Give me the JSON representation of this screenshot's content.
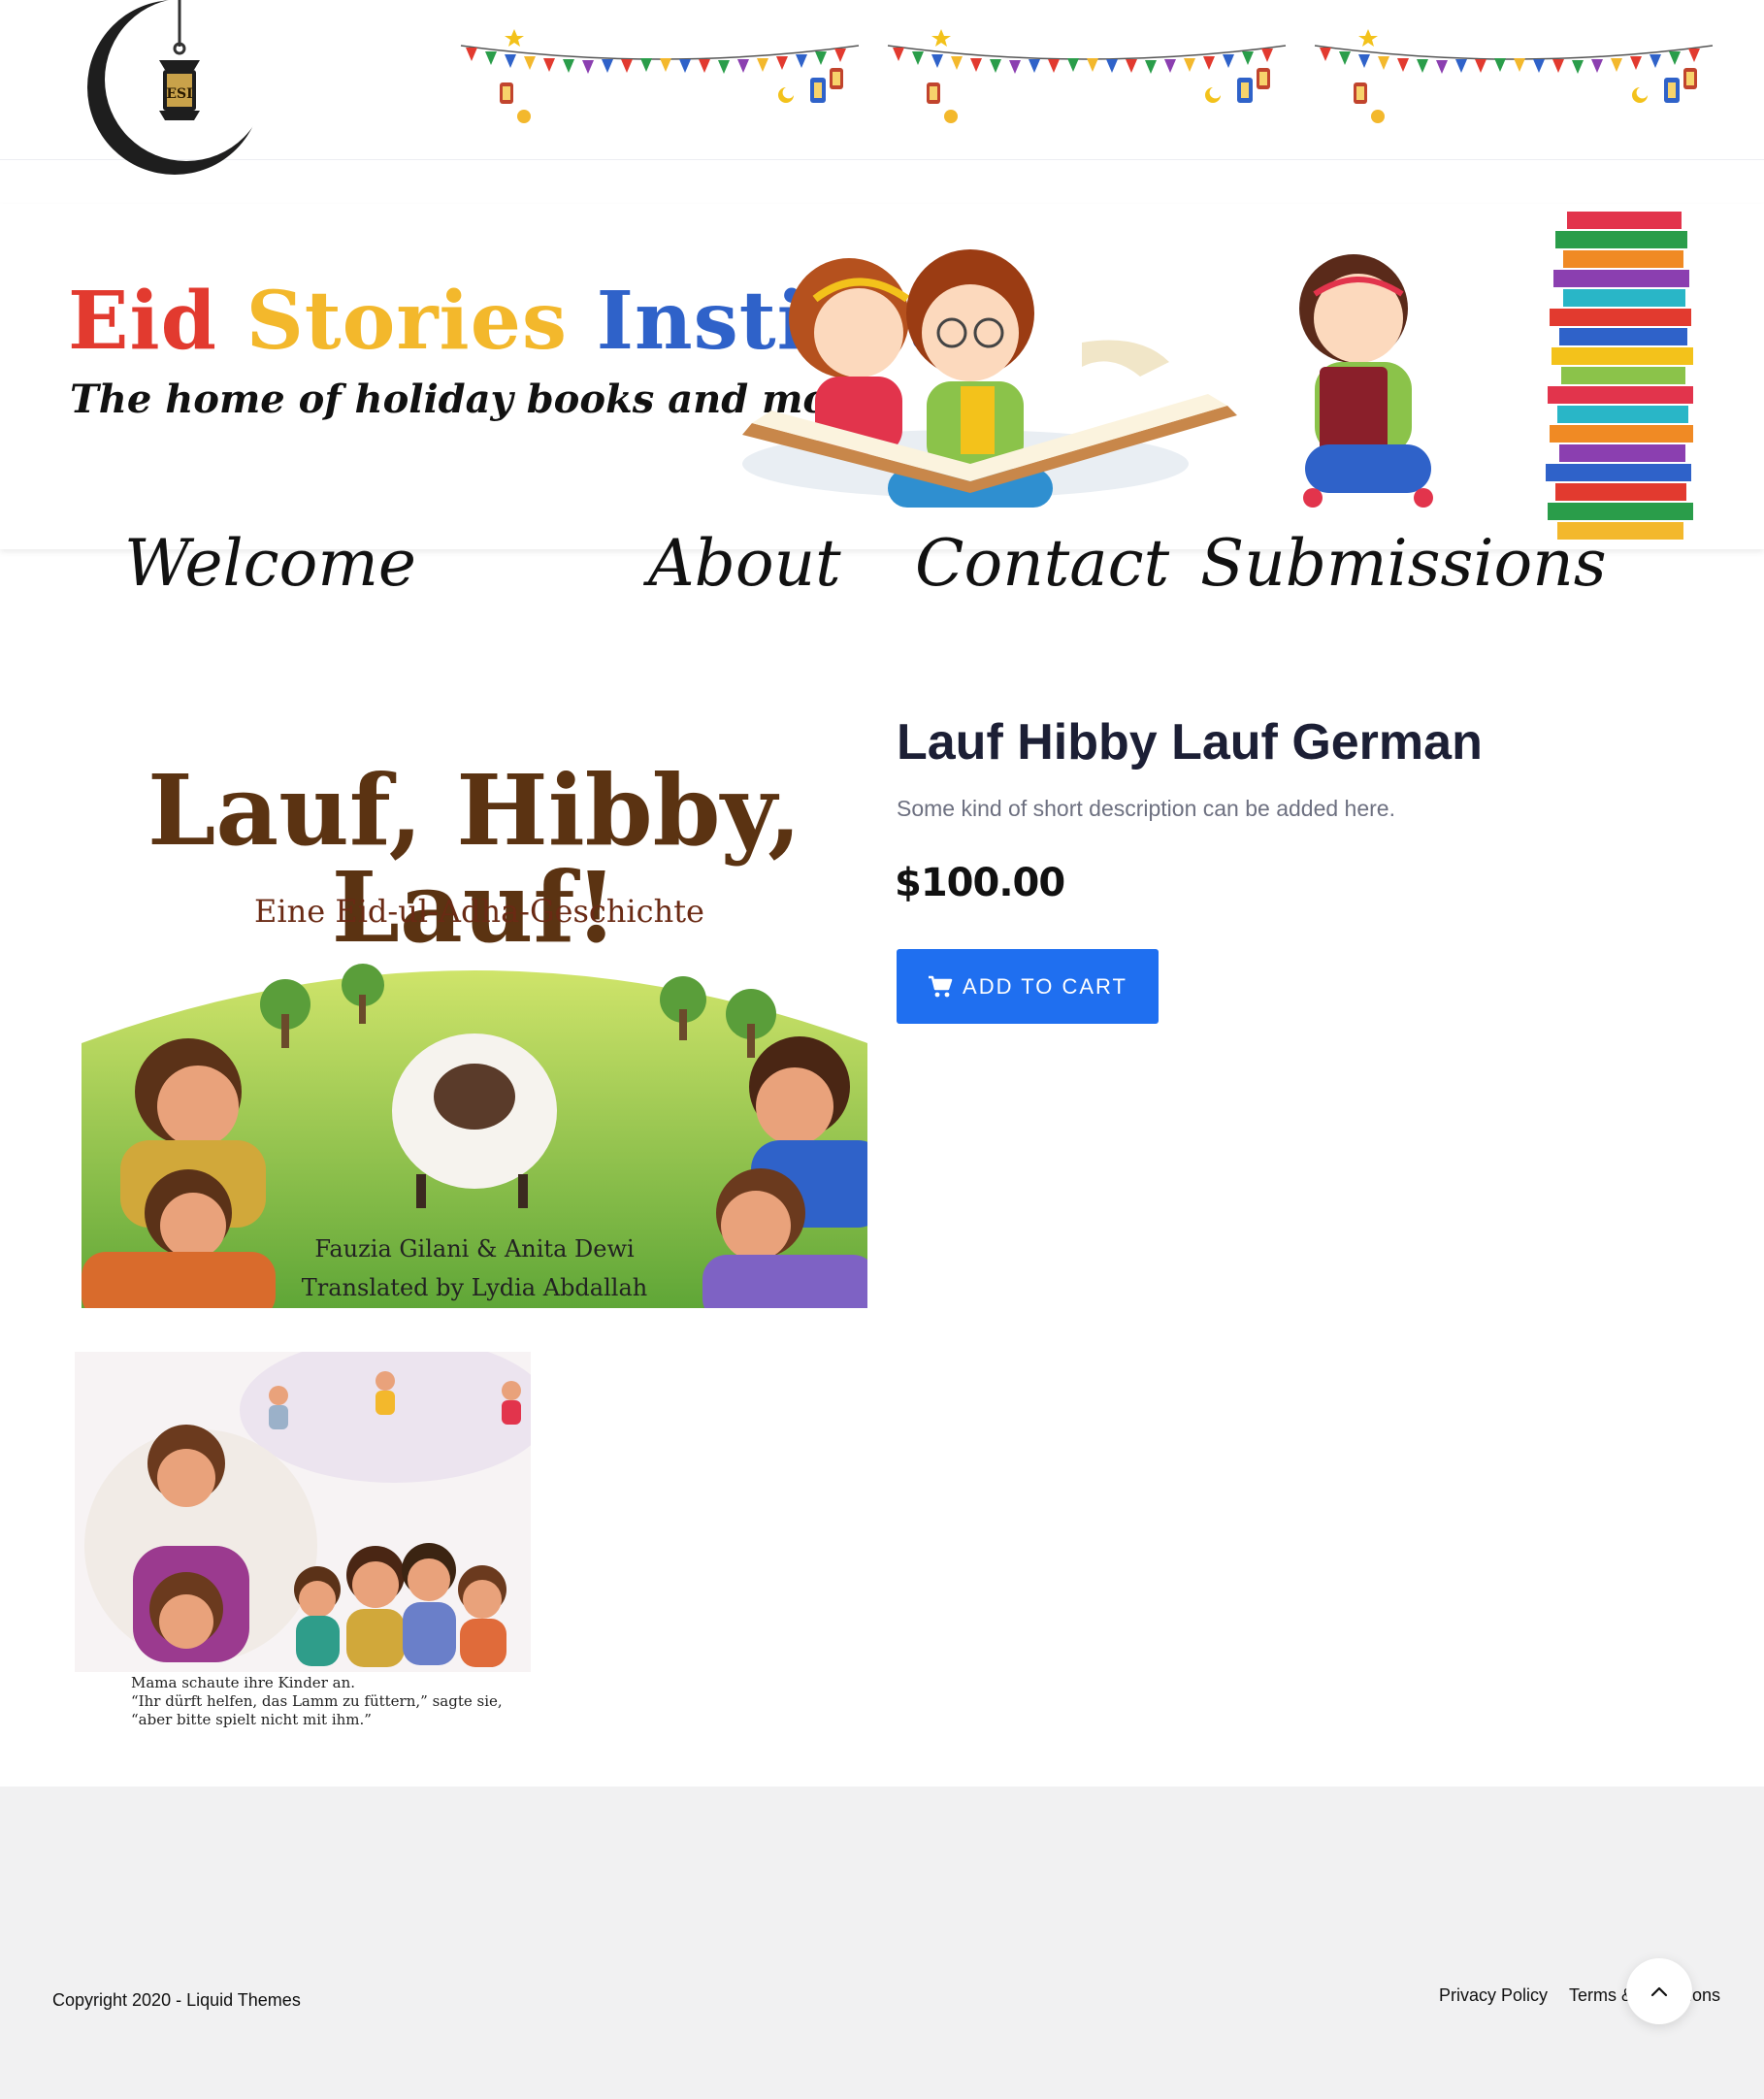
{
  "header": {
    "logo": {
      "icon": "crescent-lantern-icon",
      "lantern_text": "ESI"
    }
  },
  "banner": {
    "title_parts": [
      "Eid",
      "Stories",
      "Institute"
    ],
    "subtitle": "The home of holiday books and more!"
  },
  "nav": {
    "items": [
      "Welcome",
      "About",
      "Contact",
      "Submissions"
    ]
  },
  "product": {
    "title": "Lauf Hibby Lauf German",
    "short_description": "Some kind of short description can be added here.",
    "price": "$100.00",
    "add_to_cart_label": "ADD TO CART",
    "cart_icon": "cart-icon",
    "cover": {
      "title": "Lauf, Hibby, Lauf!",
      "subtitle": "Eine Eid-ul-Adha-Geschichte",
      "credit_line_1": "Fauzia Gilani & Anita Dewi",
      "credit_line_2": "Translated by Lydia Abdallah"
    },
    "thumbnail": {
      "caption_lines": [
        "Mama schaute ihre Kinder an.",
        "“Ihr dürft helfen, das Lamm zu füttern,” sagte sie,",
        "“aber bitte spielt nicht mit ihm.”"
      ]
    }
  },
  "footer": {
    "copyright": "Copyright 2020 - Liquid Themes",
    "links": [
      "Privacy Policy",
      "Terms & Conditions"
    ],
    "back_to_top_icon": "chevron-up-icon"
  },
  "colors": {
    "accent": "#1f6ff0",
    "heading": "#1c1f35",
    "muted": "#6d7080",
    "footer_bg": "#f1f1f2"
  }
}
